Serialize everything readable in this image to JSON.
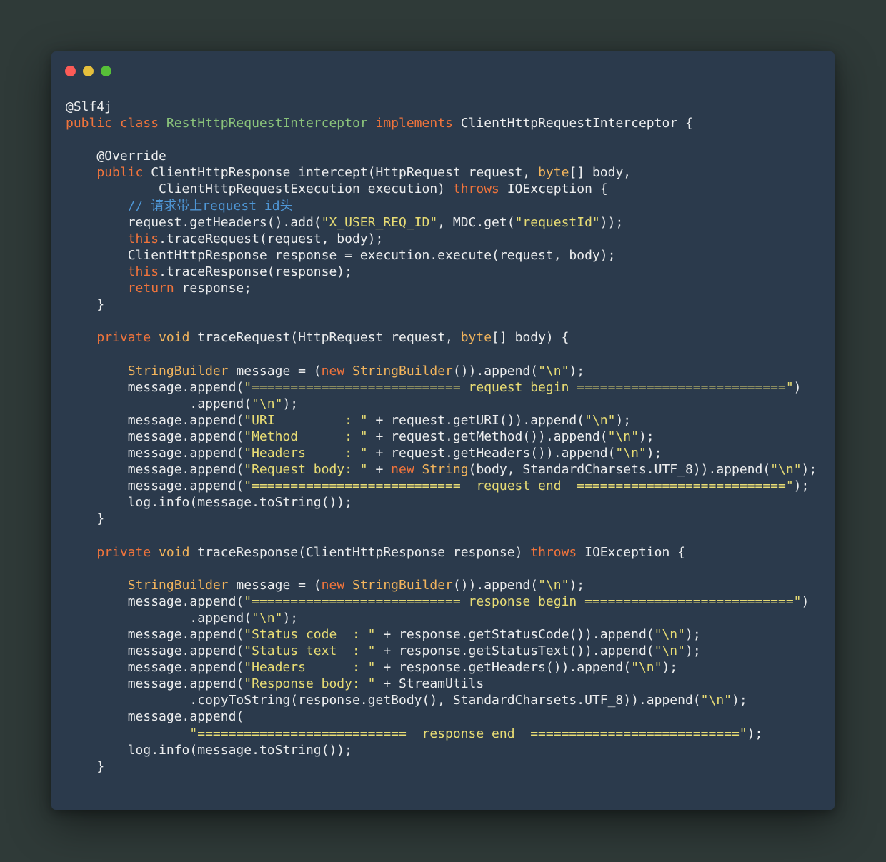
{
  "colors": {
    "background": "#2f3a38",
    "window": "#2b3a4c",
    "plain": "#ecedee",
    "keyword": "#f0743c",
    "type": "#f2b45c",
    "string": "#e8dc74",
    "comment": "#4f97d6",
    "class_name": "#8ac27a",
    "close_dot": "#fc5b57",
    "minimize_dot": "#e5bf3c",
    "maximize_dot": "#57c038"
  },
  "window_controls": [
    "close",
    "minimize",
    "maximize"
  ],
  "code_lines": [
    [
      [
        "p",
        "@Slf4j"
      ]
    ],
    [
      [
        "k",
        "public class "
      ],
      [
        "c",
        "RestHttpRequestInterceptor "
      ],
      [
        "k",
        "implements "
      ],
      [
        "p",
        "ClientHttpRequestInterceptor {"
      ]
    ],
    [],
    [
      [
        "p",
        "    @Override"
      ]
    ],
    [
      [
        "p",
        "    "
      ],
      [
        "k",
        "public "
      ],
      [
        "p",
        "ClientHttpResponse intercept(HttpRequest request, "
      ],
      [
        "t",
        "byte"
      ],
      [
        "p",
        "[] body,"
      ]
    ],
    [
      [
        "p",
        "            ClientHttpRequestExecution execution) "
      ],
      [
        "k",
        "throws "
      ],
      [
        "p",
        "IOException {"
      ]
    ],
    [
      [
        "m",
        "        // 请求带上request id头"
      ]
    ],
    [
      [
        "p",
        "        request.getHeaders().add("
      ],
      [
        "s",
        "\"X_USER_REQ_ID\""
      ],
      [
        "p",
        ", MDC.get("
      ],
      [
        "s",
        "\"requestId\""
      ],
      [
        "p",
        "));"
      ]
    ],
    [
      [
        "p",
        "        "
      ],
      [
        "k",
        "this"
      ],
      [
        "p",
        ".traceRequest(request, body);"
      ]
    ],
    [
      [
        "p",
        "        ClientHttpResponse response = execution.execute(request, body);"
      ]
    ],
    [
      [
        "p",
        "        "
      ],
      [
        "k",
        "this"
      ],
      [
        "p",
        ".traceResponse(response);"
      ]
    ],
    [
      [
        "p",
        "        "
      ],
      [
        "k",
        "return "
      ],
      [
        "p",
        "response;"
      ]
    ],
    [
      [
        "p",
        "    }"
      ]
    ],
    [],
    [
      [
        "p",
        "    "
      ],
      [
        "k",
        "private "
      ],
      [
        "t",
        "void "
      ],
      [
        "p",
        "traceRequest(HttpRequest request, "
      ],
      [
        "t",
        "byte"
      ],
      [
        "p",
        "[] body) {"
      ]
    ],
    [],
    [
      [
        "p",
        "        "
      ],
      [
        "t",
        "StringBuilder "
      ],
      [
        "p",
        "message = ("
      ],
      [
        "k",
        "new "
      ],
      [
        "t",
        "StringBuilder"
      ],
      [
        "p",
        "()).append("
      ],
      [
        "s",
        "\"\\n\""
      ],
      [
        "p",
        ");"
      ]
    ],
    [
      [
        "p",
        "        message.append("
      ],
      [
        "s",
        "\"=========================== request begin ===========================\""
      ],
      [
        "p",
        ")"
      ]
    ],
    [
      [
        "p",
        "                .append("
      ],
      [
        "s",
        "\"\\n\""
      ],
      [
        "p",
        ");"
      ]
    ],
    [
      [
        "p",
        "        message.append("
      ],
      [
        "s",
        "\"URI         : \""
      ],
      [
        "p",
        " + request.getURI()).append("
      ],
      [
        "s",
        "\"\\n\""
      ],
      [
        "p",
        ");"
      ]
    ],
    [
      [
        "p",
        "        message.append("
      ],
      [
        "s",
        "\"Method      : \""
      ],
      [
        "p",
        " + request.getMethod()).append("
      ],
      [
        "s",
        "\"\\n\""
      ],
      [
        "p",
        ");"
      ]
    ],
    [
      [
        "p",
        "        message.append("
      ],
      [
        "s",
        "\"Headers     : \""
      ],
      [
        "p",
        " + request.getHeaders()).append("
      ],
      [
        "s",
        "\"\\n\""
      ],
      [
        "p",
        ");"
      ]
    ],
    [
      [
        "p",
        "        message.append("
      ],
      [
        "s",
        "\"Request body: \""
      ],
      [
        "p",
        " + "
      ],
      [
        "k",
        "new "
      ],
      [
        "t",
        "String"
      ],
      [
        "p",
        "(body, StandardCharsets.UTF_8)).append("
      ],
      [
        "s",
        "\"\\n\""
      ],
      [
        "p",
        ");"
      ]
    ],
    [
      [
        "p",
        "        message.append("
      ],
      [
        "s",
        "\"===========================  request end  ===========================\""
      ],
      [
        "p",
        ");"
      ]
    ],
    [
      [
        "p",
        "        log.info(message.toString());"
      ]
    ],
    [
      [
        "p",
        "    }"
      ]
    ],
    [],
    [
      [
        "p",
        "    "
      ],
      [
        "k",
        "private "
      ],
      [
        "t",
        "void "
      ],
      [
        "p",
        "traceResponse(ClientHttpResponse response) "
      ],
      [
        "k",
        "throws "
      ],
      [
        "p",
        "IOException {"
      ]
    ],
    [],
    [
      [
        "p",
        "        "
      ],
      [
        "t",
        "StringBuilder "
      ],
      [
        "p",
        "message = ("
      ],
      [
        "k",
        "new "
      ],
      [
        "t",
        "StringBuilder"
      ],
      [
        "p",
        "()).append("
      ],
      [
        "s",
        "\"\\n\""
      ],
      [
        "p",
        ");"
      ]
    ],
    [
      [
        "p",
        "        message.append("
      ],
      [
        "s",
        "\"=========================== response begin ===========================\""
      ],
      [
        "p",
        ")"
      ]
    ],
    [
      [
        "p",
        "                .append("
      ],
      [
        "s",
        "\"\\n\""
      ],
      [
        "p",
        ");"
      ]
    ],
    [
      [
        "p",
        "        message.append("
      ],
      [
        "s",
        "\"Status code  : \""
      ],
      [
        "p",
        " + response.getStatusCode()).append("
      ],
      [
        "s",
        "\"\\n\""
      ],
      [
        "p",
        ");"
      ]
    ],
    [
      [
        "p",
        "        message.append("
      ],
      [
        "s",
        "\"Status text  : \""
      ],
      [
        "p",
        " + response.getStatusText()).append("
      ],
      [
        "s",
        "\"\\n\""
      ],
      [
        "p",
        ");"
      ]
    ],
    [
      [
        "p",
        "        message.append("
      ],
      [
        "s",
        "\"Headers      : \""
      ],
      [
        "p",
        " + response.getHeaders()).append("
      ],
      [
        "s",
        "\"\\n\""
      ],
      [
        "p",
        ");"
      ]
    ],
    [
      [
        "p",
        "        message.append("
      ],
      [
        "s",
        "\"Response body: \""
      ],
      [
        "p",
        " + StreamUtils"
      ]
    ],
    [
      [
        "p",
        "                .copyToString(response.getBody(), StandardCharsets.UTF_8)).append("
      ],
      [
        "s",
        "\"\\n\""
      ],
      [
        "p",
        ");"
      ]
    ],
    [
      [
        "p",
        "        message.append("
      ]
    ],
    [
      [
        "s",
        "                \"===========================  response end  ===========================\""
      ],
      [
        "p",
        ");"
      ]
    ],
    [
      [
        "p",
        "        log.info(message.toString());"
      ]
    ],
    [
      [
        "p",
        "    }"
      ]
    ]
  ]
}
